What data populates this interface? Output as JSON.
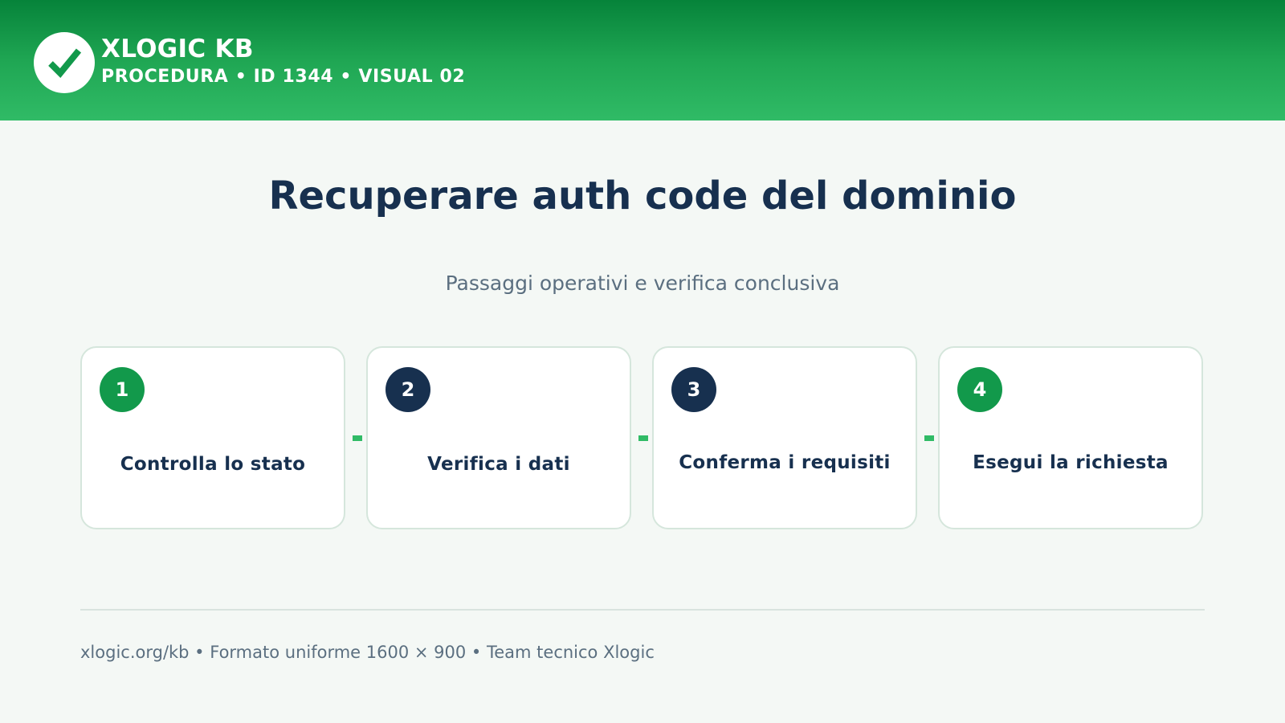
{
  "header": {
    "brand": "XLOGIC KB",
    "subtitle": "PROCEDURA • ID 1344 • VISUAL 02",
    "logo_icon": "checkmark-icon",
    "colors": {
      "gradient_top": "#06833a",
      "gradient_bottom": "#30bb66"
    }
  },
  "main": {
    "title": "Recuperare auth code del dominio",
    "subtitle": "Passaggi operativi e verifica conclusiva"
  },
  "steps": [
    {
      "number": "1",
      "label": "Controlla lo stato",
      "badge_color": "#12994b"
    },
    {
      "number": "2",
      "label": "Verifica i dati",
      "badge_color": "#17304f"
    },
    {
      "number": "3",
      "label": "Conferma i requisiti",
      "badge_color": "#17304f"
    },
    {
      "number": "4",
      "label": "Esegui la richiesta",
      "badge_color": "#12994b"
    }
  ],
  "footer": {
    "text": "xlogic.org/kb • Formato uniforme 1600 × 900 • Team tecnico Xlogic"
  },
  "colors": {
    "accent": "#30bb66",
    "navy": "#17304f",
    "background": "#f4f8f5"
  }
}
